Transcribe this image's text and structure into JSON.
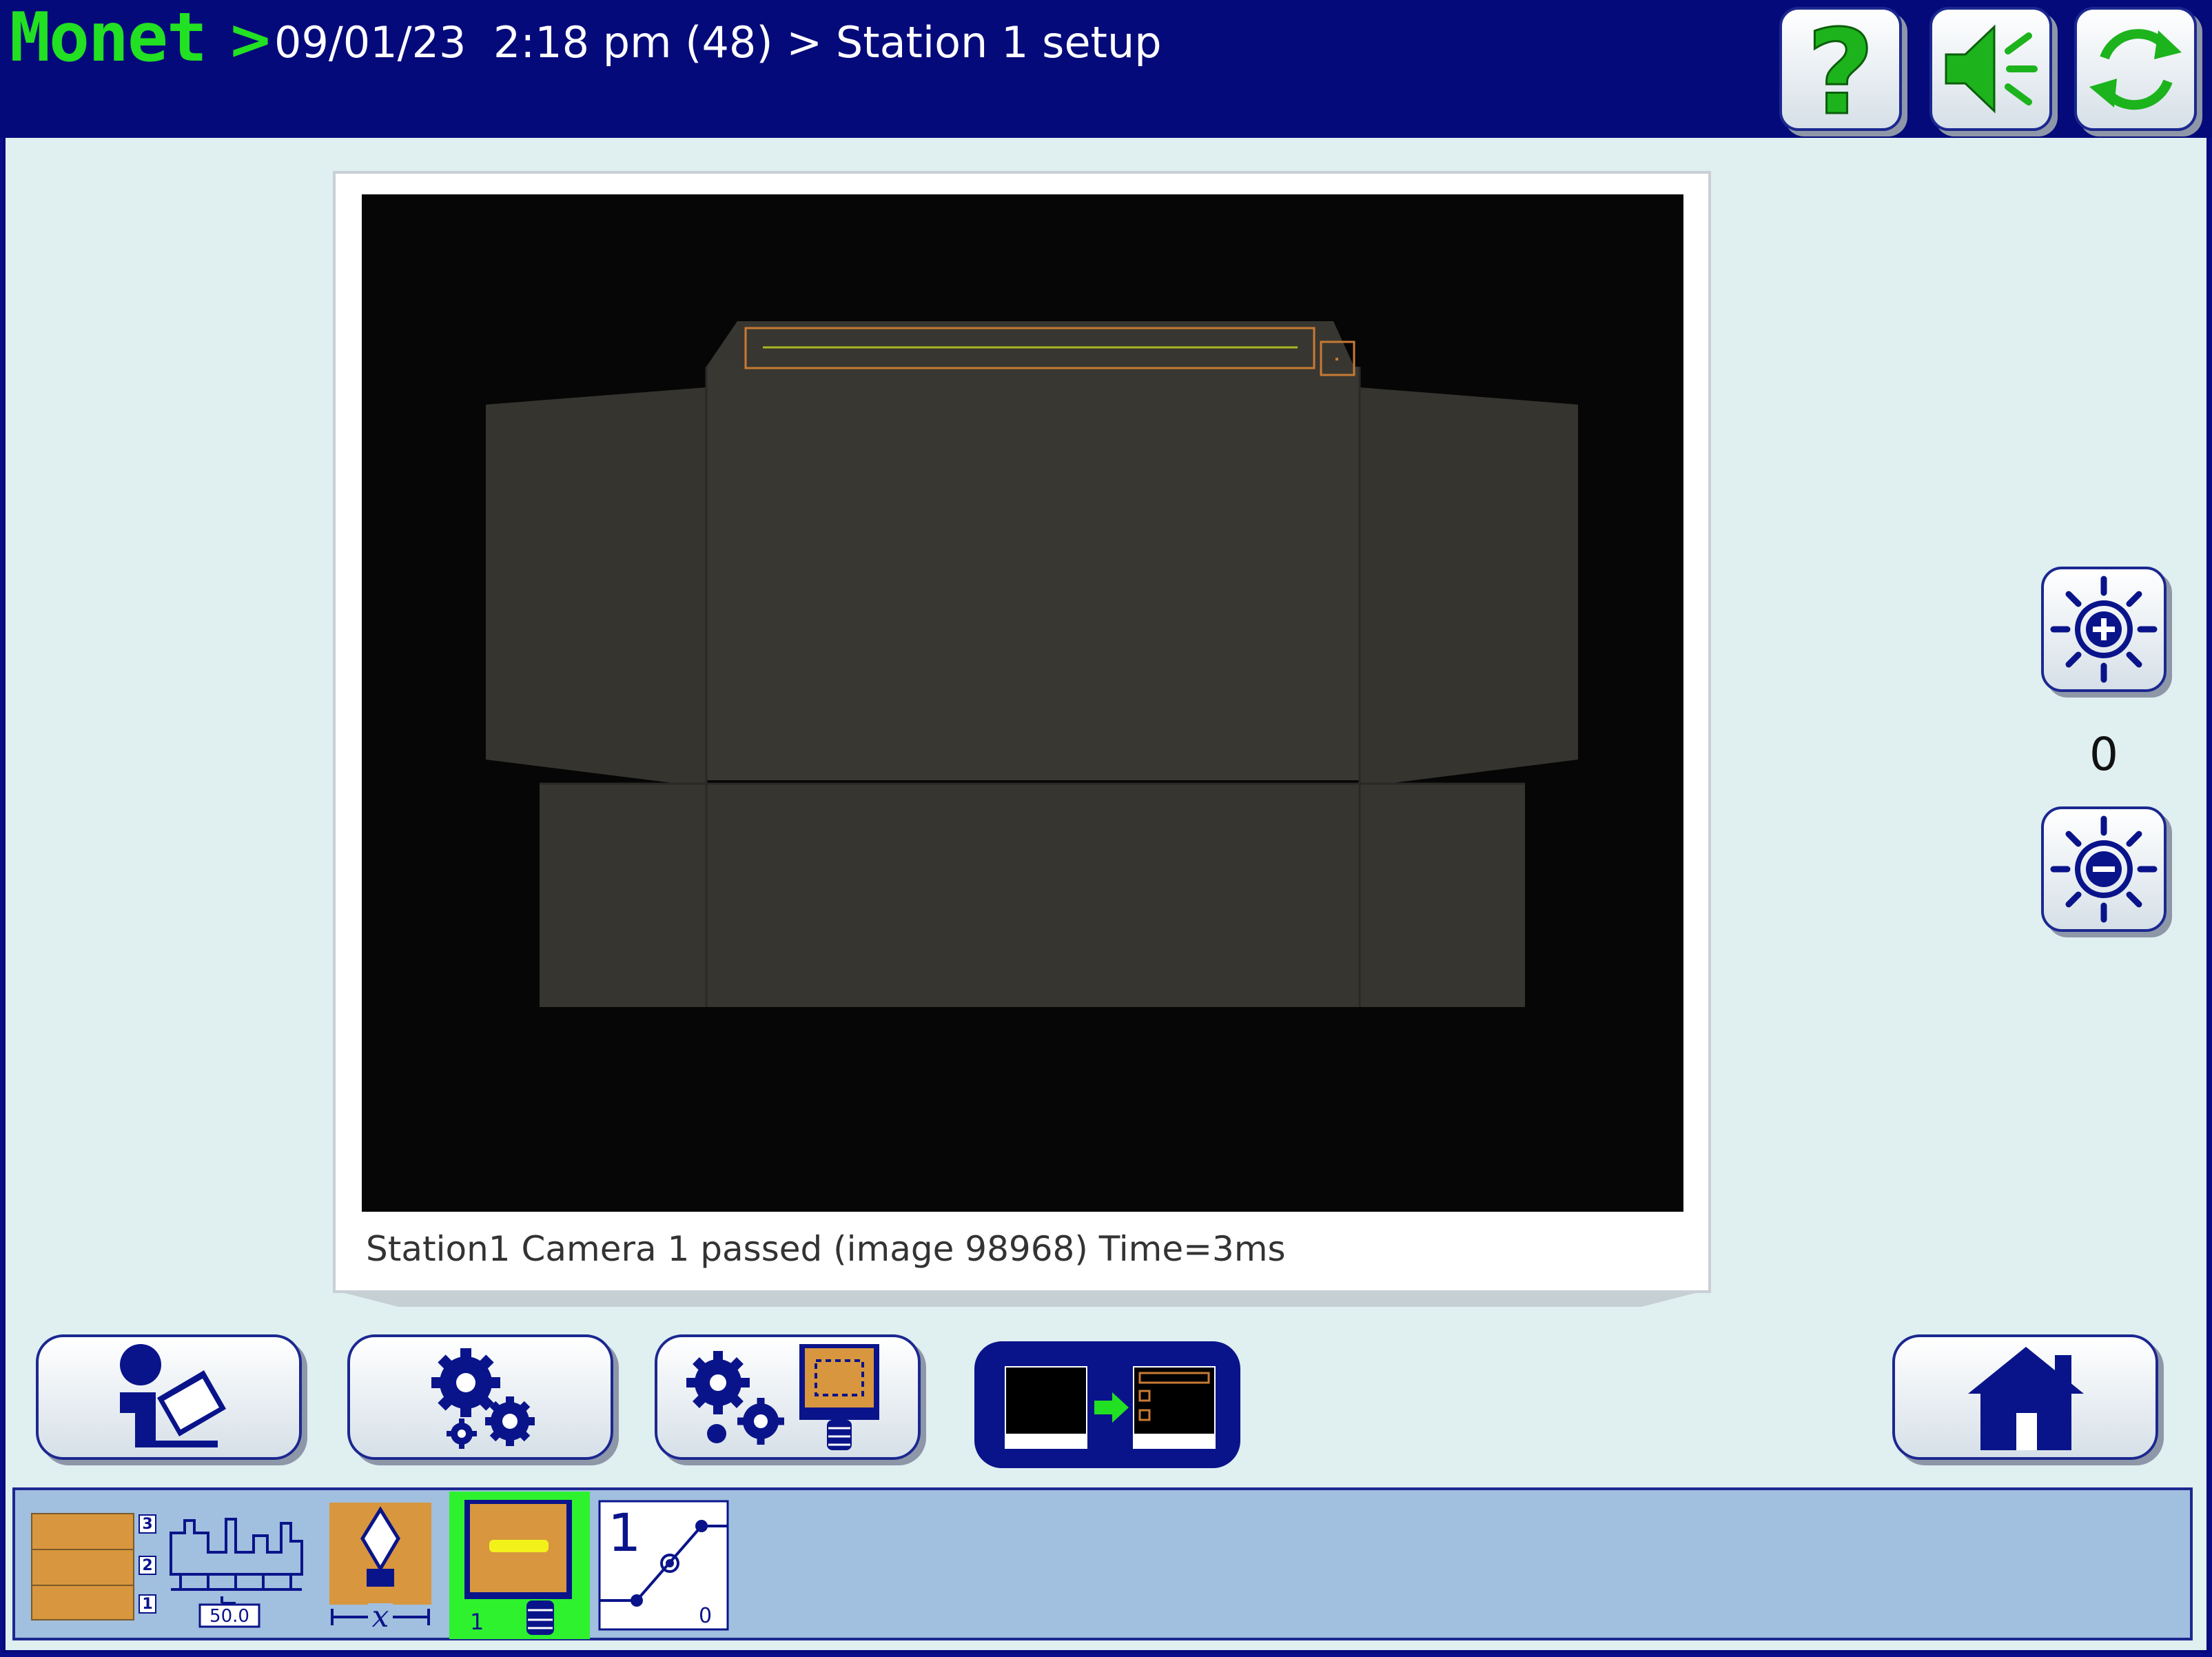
{
  "header": {
    "brand": "Monet",
    "breadcrumb": "09/01/23  2:18 pm (48) > Station 1 setup",
    "buttons": [
      {
        "icon": "help-icon",
        "color": "#1db31d"
      },
      {
        "icon": "speaker-icon",
        "color": "#1db31d"
      },
      {
        "icon": "refresh-icon",
        "color": "#1db31d"
      }
    ]
  },
  "viewer": {
    "status": "Station1 Camera 1 passed (image 98968) Time=3ms"
  },
  "brightness": {
    "value": "0",
    "increase_icon": "brightness-plus-icon",
    "decrease_icon": "brightness-minus-icon"
  },
  "bottom_buttons": [
    {
      "icon": "operator-log-icon"
    },
    {
      "icon": "settings-gears-icon"
    },
    {
      "icon": "camera-settings-icon"
    },
    {
      "icon": "image-to-inspection-icon",
      "active": true
    },
    {
      "icon": "home-icon"
    }
  ],
  "tray": {
    "tools": [
      {
        "icon": "station-layout-icon",
        "value": "50.0",
        "levels": [
          "3",
          "2",
          "1"
        ]
      },
      {
        "icon": "camera-position-icon",
        "label": "x"
      },
      {
        "icon": "inspection-tool-icon",
        "index": "1",
        "selected": true
      },
      {
        "icon": "output-mapping-icon",
        "left": "1",
        "right": "0"
      }
    ]
  },
  "colors": {
    "navy": "#050a7a",
    "brand_green": "#22e022",
    "accent_green": "#1db31d",
    "roi_orange": "#c87a34",
    "selected_green": "#2ef22e"
  }
}
